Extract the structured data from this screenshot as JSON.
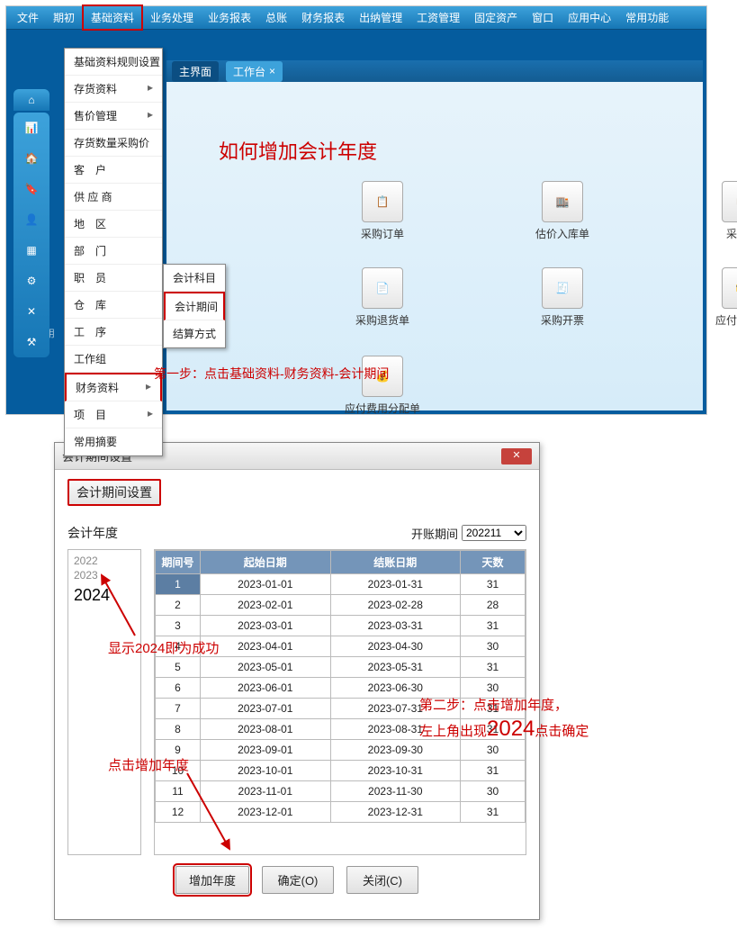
{
  "menubar": {
    "items": [
      "文件",
      "期初",
      "基础资料",
      "业务处理",
      "业务报表",
      "总账",
      "财务报表",
      "出纳管理",
      "工资管理",
      "固定资产",
      "窗口",
      "应用中心",
      "常用功能"
    ]
  },
  "dropdown": {
    "items": [
      "基础资料规则设置",
      "存货资料",
      "售价管理",
      "存货数量采购价",
      "客　户",
      "供 应 商",
      "地　区",
      "部　门",
      "职　员",
      "仓　库",
      "工　序",
      "工作组",
      "财务资料",
      "项　目",
      "常用摘要"
    ],
    "finance_index": 12,
    "submenu": [
      "会计科目",
      "会计期间",
      "结算方式"
    ]
  },
  "tabs": {
    "main": "主界面",
    "work": "工作台",
    "close": "×"
  },
  "heading": "如何增加会计年度",
  "desk": {
    "icons": [
      {
        "label": "采购订单",
        "glyph": "📋"
      },
      {
        "label": "估价入库单",
        "glyph": "🏬"
      },
      {
        "label": "采购单",
        "glyph": "📦"
      },
      {
        "label": "采购退货单",
        "glyph": "📄"
      },
      {
        "label": "采购开票",
        "glyph": "🧾"
      },
      {
        "label": "应付费用单",
        "glyph": "💳"
      }
    ],
    "extra": {
      "label": "应付费用分配单",
      "glyph": "💰"
    }
  },
  "side_more": "更多应用",
  "step1": "第一步：点击基础资料-财务资料-会计期间",
  "dialog": {
    "title": "会计期间设置",
    "subtitle": "会计期间设置",
    "year_label": "会计年度",
    "open_period_label": "开账期间",
    "open_period_value": "202211",
    "years_old": [
      "2022",
      "2023"
    ],
    "year_new": "2024",
    "headers": [
      "期间号",
      "起始日期",
      "结账日期",
      "天数"
    ],
    "rows": [
      {
        "n": "1",
        "s": "2023-01-01",
        "e": "2023-01-31",
        "d": "31"
      },
      {
        "n": "2",
        "s": "2023-02-01",
        "e": "2023-02-28",
        "d": "28"
      },
      {
        "n": "3",
        "s": "2023-03-01",
        "e": "2023-03-31",
        "d": "31"
      },
      {
        "n": "4",
        "s": "2023-04-01",
        "e": "2023-04-30",
        "d": "30"
      },
      {
        "n": "5",
        "s": "2023-05-01",
        "e": "2023-05-31",
        "d": "31"
      },
      {
        "n": "6",
        "s": "2023-06-01",
        "e": "2023-06-30",
        "d": "30"
      },
      {
        "n": "7",
        "s": "2023-07-01",
        "e": "2023-07-31",
        "d": "31"
      },
      {
        "n": "8",
        "s": "2023-08-01",
        "e": "2023-08-31",
        "d": "31"
      },
      {
        "n": "9",
        "s": "2023-09-01",
        "e": "2023-09-30",
        "d": "30"
      },
      {
        "n": "10",
        "s": "2023-10-01",
        "e": "2023-10-31",
        "d": "31"
      },
      {
        "n": "11",
        "s": "2023-11-01",
        "e": "2023-11-30",
        "d": "30"
      },
      {
        "n": "12",
        "s": "2023-12-01",
        "e": "2023-12-31",
        "d": "31"
      }
    ],
    "buttons": {
      "add": "增加年度",
      "ok": "确定(O)",
      "close": "关闭(C)"
    }
  },
  "annot": {
    "show2024a": "显示2024",
    "show2024b": "即为成功",
    "addyear_hint": "点击增加年度",
    "step2a": "第二步：点击增加年度，",
    "step2b_pre": "左上角出现",
    "step2b_big": "2024",
    "step2b_post": "点击确定"
  }
}
